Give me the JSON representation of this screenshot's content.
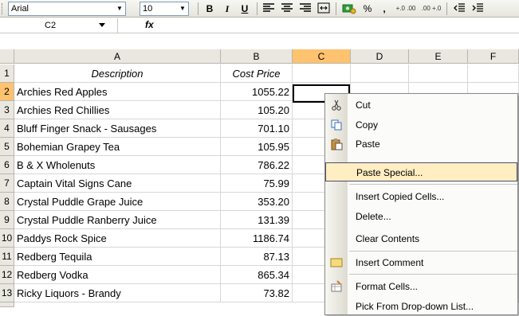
{
  "toolbar": {
    "font_name": "Arial",
    "font_size": "10",
    "bold_label": "B",
    "italic_label": "I",
    "underline_label": "U",
    "percent_label": "%",
    "comma_label": ",",
    "inc_decimal_label": "+.0 .00",
    "dec_decimal_label": ".00 +.0"
  },
  "formula_bar": {
    "name_box": "C2",
    "fx_label": "fx",
    "formula": ""
  },
  "columns": [
    "A",
    "B",
    "C",
    "D",
    "E",
    "F"
  ],
  "rows": [
    {
      "num": "1",
      "description": "Description",
      "cost": "Cost Price"
    },
    {
      "num": "2",
      "description": "Archies Red Apples",
      "cost": "1055.22"
    },
    {
      "num": "3",
      "description": "Archies Red Chillies",
      "cost": "105.20"
    },
    {
      "num": "4",
      "description": "Bluff Finger Snack - Sausages",
      "cost": "701.10"
    },
    {
      "num": "5",
      "description": "Bohemian Grapey Tea",
      "cost": "105.95"
    },
    {
      "num": "6",
      "description": "B & X Wholenuts",
      "cost": "786.22"
    },
    {
      "num": "7",
      "description": "Captain Vital Signs Cane",
      "cost": "75.99"
    },
    {
      "num": "8",
      "description": "Crystal Puddle Grape Juice",
      "cost": "353.20"
    },
    {
      "num": "9",
      "description": "Crystal Puddle Ranberry Juice",
      "cost": "131.39"
    },
    {
      "num": "10",
      "description": "Paddys Rock Spice",
      "cost": "1186.74"
    },
    {
      "num": "11",
      "description": "Redberg Tequila",
      "cost": "87.13"
    },
    {
      "num": "12",
      "description": "Redberg Vodka",
      "cost": "865.34"
    },
    {
      "num": "13",
      "description": "Ricky Liquors - Brandy",
      "cost": "73.82"
    }
  ],
  "context_menu": {
    "cut": "Cut",
    "copy": "Copy",
    "paste": "Paste",
    "paste_special": "Paste Special...",
    "insert_copied_cells": "Insert Copied Cells...",
    "delete": "Delete...",
    "clear_contents": "Clear Contents",
    "insert_comment": "Insert Comment",
    "format_cells": "Format Cells...",
    "pick_from_list": "Pick From Drop-down List..."
  },
  "colors": {
    "selected_header": "#ffc26e",
    "menu_highlight": "#ffeec2"
  }
}
